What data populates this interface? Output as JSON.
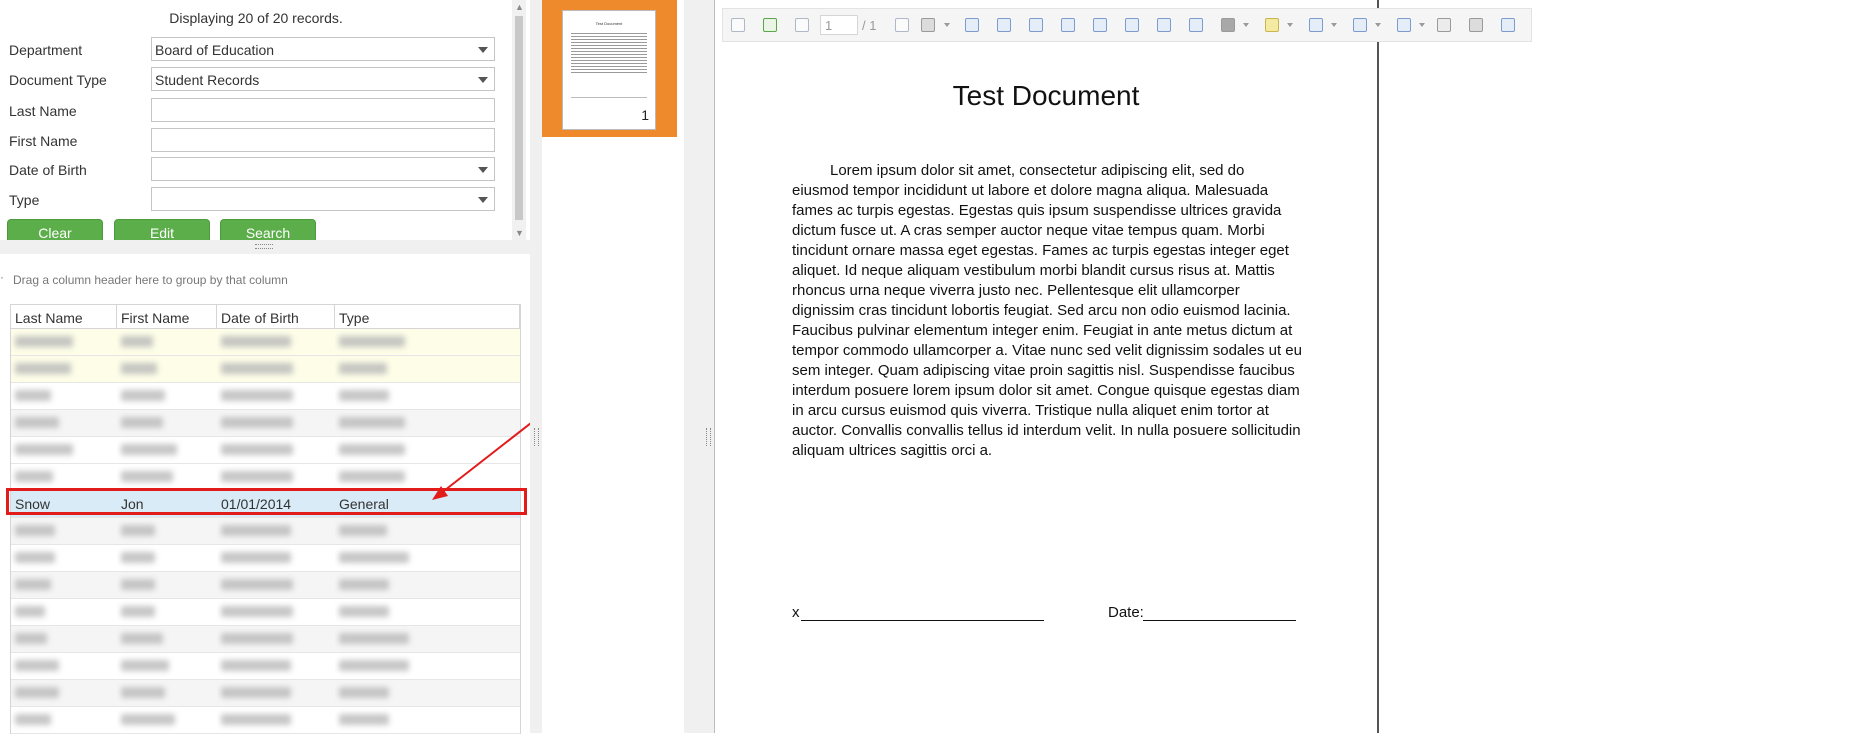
{
  "search": {
    "records_message": "Displaying 20 of 20 records.",
    "fields": [
      {
        "label": "Department",
        "value": "Board of Education",
        "dropdown": true
      },
      {
        "label": "Document Type",
        "value": "Student Records",
        "dropdown": true
      },
      {
        "label": "Last Name",
        "value": "",
        "dropdown": false
      },
      {
        "label": "First Name",
        "value": "",
        "dropdown": false
      },
      {
        "label": "Date of Birth",
        "value": "",
        "dropdown": true
      },
      {
        "label": "Type",
        "value": "",
        "dropdown": true
      }
    ],
    "buttons": {
      "clear": "Clear",
      "edit": "Edit",
      "search": "Search"
    },
    "button_color": "#5cae4b"
  },
  "grid": {
    "group_hint": "Drag a column header here to group by that column",
    "columns": [
      "Last Name",
      "First Name",
      "Date of Birth",
      "Type"
    ],
    "selected_row": {
      "last_name": "Snow",
      "first_name": "Jon",
      "dob": "01/01/2014",
      "type": "General"
    },
    "highlight_color": "#e21b1b",
    "row_count": 15
  },
  "thumbnails": {
    "page_label": "1",
    "accent": "#ee8a2c"
  },
  "viewer": {
    "toolbar": {
      "page_value": "1",
      "page_total": "/ 1"
    },
    "document": {
      "title": "Test Document",
      "body": "Lorem ipsum dolor sit amet, consectetur adipiscing elit, sed do eiusmod tempor incididunt ut labore et dolore magna aliqua. Malesuada fames ac turpis egestas. Egestas quis ipsum suspendisse ultrices gravida dictum fusce ut. A cras semper auctor neque vitae tempus quam. Morbi tincidunt ornare massa eget egestas. Fames ac turpis egestas integer eget aliquet. Id neque aliquam vestibulum morbi blandit cursus risus at. Mattis rhoncus urna neque viverra justo nec. Pellentesque elit ullamcorper dignissim cras tincidunt lobortis feugiat. Sed arcu non odio euismod lacinia. Faucibus pulvinar elementum integer enim. Feugiat in ante metus dictum at tempor commodo ullamcorper a. Vitae nunc sed velit dignissim sodales ut eu sem integer. Quam adipiscing vitae proin sagittis nisl. Suspendisse faucibus interdum posuere lorem ipsum dolor sit amet. Congue quisque egestas diam in arcu cursus euismod quis viverra. Tristique nulla aliquet enim tortor at auctor. Convallis convallis tellus id interdum velit. In nulla posuere sollicitudin aliquam ultrices sagittis orci a.",
      "signature_x": "x",
      "signature_date": "Date:"
    }
  }
}
